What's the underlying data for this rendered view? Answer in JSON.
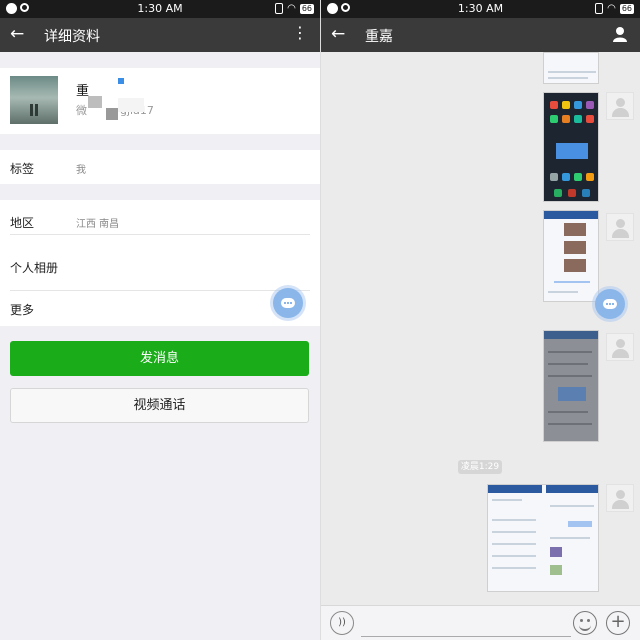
{
  "status_bar": {
    "time": "1:30 AM",
    "battery": "66"
  },
  "left": {
    "nav": {
      "back": "←",
      "title": "详细资料",
      "more": "⋮"
    },
    "profile": {
      "nickname": "重",
      "wechat_id": "微　　　gjia17"
    },
    "tag": {
      "label": "标签",
      "value": "我"
    },
    "region": {
      "label": "地区",
      "value": "江西  南昌"
    },
    "album": {
      "label": "个人相册"
    },
    "more": {
      "label": "更多"
    },
    "send_message_button": "发消息",
    "video_call_button": "视频通话"
  },
  "right": {
    "nav": {
      "back": "←",
      "title": "重嘉"
    },
    "timestamp": "凌晨1:29",
    "input": {
      "voice": "))",
      "plus": "+"
    }
  },
  "colors": {
    "primary_green": "#1aad19",
    "nav_bar": "#3a3a3a",
    "status_bar": "#1b1b1b"
  },
  "icons": [
    "back-arrow-icon",
    "more-vertical-icon",
    "profile-person-icon",
    "floating-chat-icon",
    "voice-icon",
    "emoji-icon",
    "plus-icon"
  ]
}
